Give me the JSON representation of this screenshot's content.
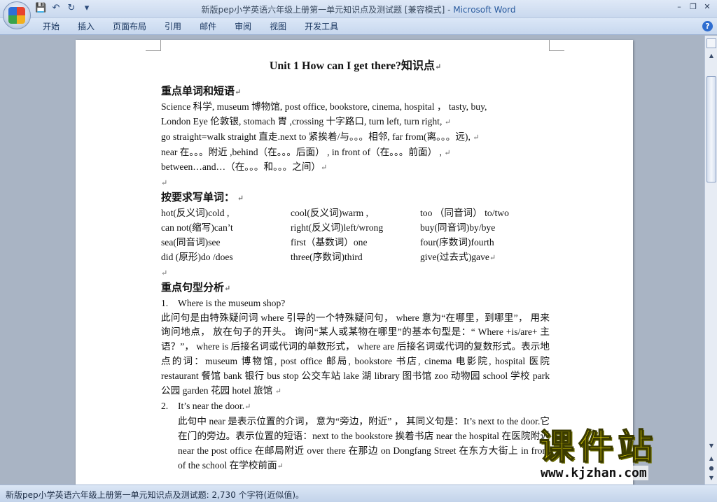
{
  "window": {
    "title": "新版pep小学英语六年级上册第一单元知识点及测试题 [兼容模式] - ",
    "app": "Microsoft Word"
  },
  "qat": {
    "save_icon": "💾",
    "undo_icon": "↶",
    "redo_icon": "↻",
    "more_icon": "▾"
  },
  "win_controls": {
    "min": "–",
    "restore": "❐",
    "close": "✕"
  },
  "tabs": [
    "开始",
    "插入",
    "页面布局",
    "引用",
    "邮件",
    "审阅",
    "视图",
    "开发工具"
  ],
  "help": "?",
  "doc": {
    "title": "Unit 1 How can I get there?知识点",
    "h1": "重点单词和短语",
    "vocab": [
      "Science 科学, museum 博物馆, post office, bookstore, cinema, hospital ， tasty, buy,",
      "London Eye 伦敦银, stomach 胃 ,crossing 十字路口, turn left, turn right,",
      "go straight=walk straight 直走.next to 紧挨着/与。。。相邻, far from(离。。。远),",
      "near 在。。。附近 ,behind（在。。。后面） , in front of（在。。。前面） ,",
      "between…and…（在。。。和。。。之间）"
    ],
    "h2": "按要求写单词：",
    "words": [
      [
        "hot(反义词)cold ,",
        "cool(反义词)warm ,",
        "too （同音词） to/two"
      ],
      [
        "can not(缩写)can’t",
        "right(反义词)left/wrong",
        "buy(同音词)by/bye"
      ],
      [
        "sea(同音词)see",
        "first（基数词）one",
        "four(序数词)fourth"
      ],
      [
        "did (原形)do /does",
        "three(序数词)third",
        "give(过去式)gave"
      ]
    ],
    "h3": "重点句型分析",
    "item1_num": "1.",
    "item1": "Where is the museum shop?",
    "para1": "此问句是由特殊疑问词 where 引导的一个特殊疑问句， where 意为“在哪里，到哪里”， 用来询问地点， 放在句子的开头。 询问“某人或某物在哪里”的基本句型是：“ Where +is/are+ 主语？”， where is 后接名词或代词的单数形式， where are 后接名词或代词的复数形式。表示地点的词：museum 博物馆, post office 邮局, bookstore 书店, cinema 电影院, hospital 医院 restaurant 餐馆 bank 银行 bus stop 公交车站 lake 湖 library 图书馆 zoo 动物园 school 学校 park 公园 garden 花园 hotel 旅馆",
    "item2_num": "2.",
    "item2": "It’s near the door.",
    "para2": "此句中 near 是表示位置的介词， 意为“旁边，附近” ， 其同义句是：It’s next to the door.它在门的旁边。表示位置的短语：next to the bookstore 挨着书店 near the hospital 在医院附近 near the post office 在邮局附近 over there 在那边 on Dongfang Street 在东方大街上 in front of the school 在学校前面"
  },
  "para_mark": "↵",
  "status": "新版pep小学英语六年级上册第一单元知识点及测试题: 2,730 个字符(近似值)。",
  "watermark": {
    "text": "课件站",
    "url": "www.kjzhan.com"
  },
  "colors": {
    "ribbon": "#c7d7ee",
    "doc_bg": "#a9b4c4",
    "watermark": "#f7e600"
  }
}
